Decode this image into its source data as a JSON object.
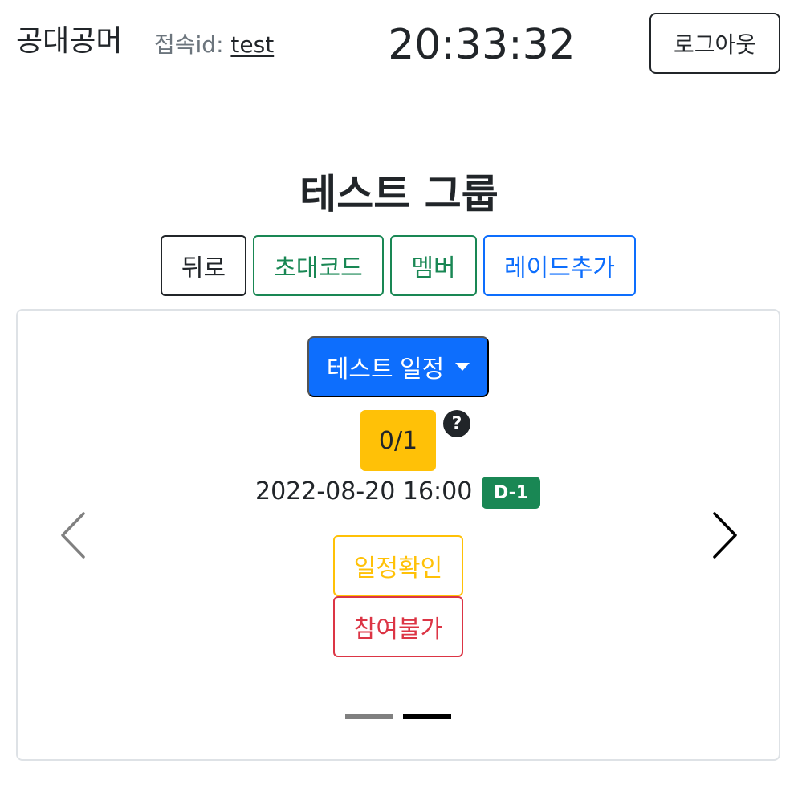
{
  "header": {
    "brand": "공대공머",
    "connection_label": "접속id:",
    "user_id": "test",
    "clock": "20:33:32",
    "logout_label": "로그아웃"
  },
  "group": {
    "title": "테스트 그룹"
  },
  "actions": {
    "back_label": "뒤로",
    "invite_code_label": "초대코드",
    "member_label": "멤버",
    "add_raid_label": "레이드추가"
  },
  "schedule": {
    "dropdown_label": "테스트 일정",
    "participants": "0/1",
    "help_icon": "?",
    "datetime": "2022-08-20 16:00",
    "dday": "D-1",
    "confirm_label": "일정확인",
    "decline_label": "참여불가"
  },
  "carousel": {
    "slide_count": 2,
    "active_index": 1
  },
  "colors": {
    "primary": "#0d6efd",
    "success": "#198754",
    "warning": "#ffc107",
    "danger": "#dc3545",
    "dark": "#212529"
  },
  "icons": {
    "prev": "chevron-left-icon",
    "next": "chevron-right-icon",
    "help": "question-circle-icon",
    "dropdown": "caret-down-icon"
  }
}
